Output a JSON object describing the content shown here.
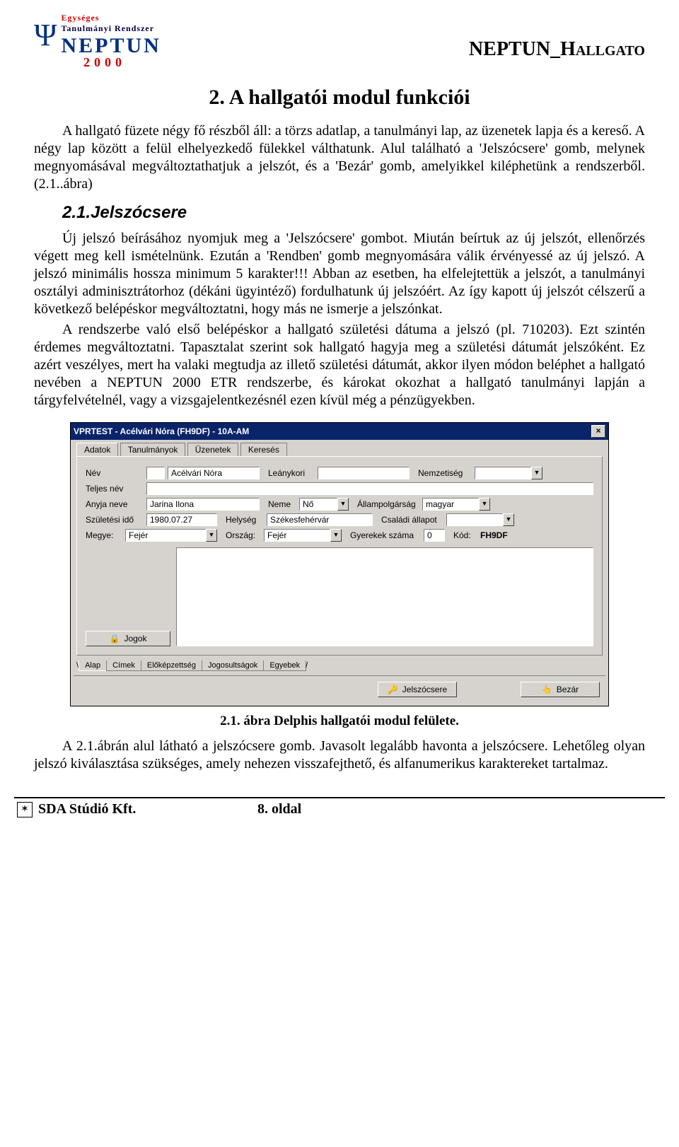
{
  "header": {
    "logo_top1": "Egységes",
    "logo_top2": "Tanulmányi  Rendszer",
    "logo_word": "NEPTUN",
    "logo_year": "2000",
    "title": "NEPTUN_Hallgato"
  },
  "section_no": "2. A hallgatói modul funkciói",
  "para1": "A hallgató füzete négy fő részből áll: a törzs adatlap, a tanulmányi lap, az üzenetek lapja és a kereső. A négy lap között a felül elhelyezkedő fülekkel válthatunk. Alul található a 'Jelszócsere' gomb, melynek megnyomásával megváltoztathatjuk a jelszót, és a 'Bezár' gomb, amelyikkel kiléphetünk a rendszerből. (2.1..ábra)",
  "sub1": "2.1.Jelszócsere",
  "para2": "Új jelszó beírásához nyomjuk meg a 'Jelszócsere' gombot. Miután beírtuk az új jelszót, ellenőrzés végett meg kell ismételnünk. Ezután a 'Rendben' gomb megnyomására válik érvényessé az új jelszó. A jelszó minimális hossza minimum 5 karakter!!! Abban az esetben, ha elfelejtettük a jelszót, a tanulmányi osztályi adminisztrátorhoz (dékáni ügyintéző) fordulhatunk új jelszóért. Az így kapott új jelszót célszerű a következő belépéskor megváltoztatni, hogy más ne ismerje a jelszónkat.",
  "para3": "A rendszerbe való első belépéskor a hallgató születési dátuma a jelszó (pl. 710203). Ezt szintén érdemes megváltoztatni. Tapasztalat szerint sok hallgató hagyja meg a születési dátumát jelszóként. Ez azért veszélyes, mert ha valaki megtudja az illető születési dátumát, akkor ilyen módon beléphet a hallgató nevében a NEPTUN 2000 ETR rendszerbe, és károkat okozhat a hallgató tanulmányi lapján a tárgyfelvételnél, vagy a vizsgajelentkezésnél ezen kívül még a pénzügyekben.",
  "dialog": {
    "title": "VPRTEST - Acélvári Nóra (FH9DF) - 10A-AM",
    "tabs": [
      "Adatok",
      "Tanulmányok",
      "Üzenetek",
      "Keresés"
    ],
    "labels": {
      "nev": "Név",
      "leanykori": "Leánykori",
      "nemzetiseg": "Nemzetiség",
      "teljesnev": "Teljes név",
      "anyja": "Anyja neve",
      "neme": "Neme",
      "allampolg": "Állampolgárság",
      "szulido": "Születési idő",
      "helyseg": "Helység",
      "csaladi": "Családi állapot",
      "megye": "Megye:",
      "orszag": "Ország:",
      "gyerek": "Gyerekek száma",
      "kod": "Kód:",
      "jogok_btn": "Jogok",
      "jelszocsere_btn": "Jelszócsere",
      "bezar_btn": "Bezár"
    },
    "values": {
      "nev": "Acélvári Nóra",
      "anyja": "Jarina Ilona",
      "neme": "Nő",
      "allampolg": "magyar",
      "szulido": "1980.07.27",
      "helyseg": "Székesfehérvár",
      "megye": "Fejér",
      "orszag": "Fejér",
      "gyerek": "0",
      "kod": "FH9DF"
    },
    "bottom_tabs": [
      "Alap",
      "Címek",
      "Előképzettség",
      "Jogosultságok",
      "Egyebek"
    ]
  },
  "caption": "2.1. ábra Delphis hallgatói modul felülete.",
  "para4": "A 2.1.ábrán alul látható a jelszócsere gomb. Javasolt legalább havonta a jelszócsere. Lehetőleg olyan jelszó kiválasztása szükséges, amely nehezen visszafejthető, és alfanumerikus karaktereket tartalmaz.",
  "footer": {
    "company": "SDA Stúdió Kft.",
    "page": "8. oldal"
  }
}
